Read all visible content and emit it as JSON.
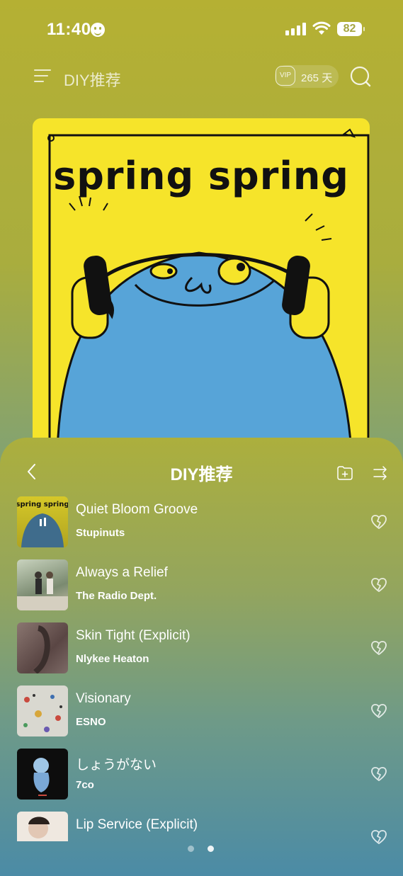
{
  "status": {
    "time": "11:40",
    "battery": "82"
  },
  "header": {
    "title": "DIY推荐",
    "vip_label": "VIP",
    "vip_days": "265 天"
  },
  "cover": {
    "text": "spring spring"
  },
  "sheet": {
    "title": "DIY推荐",
    "songs": [
      {
        "title": "Quiet Bloom Groove",
        "artist": "Stupinuts",
        "thumb_color": "#e6d430"
      },
      {
        "title": "Always a Relief",
        "artist": "The Radio Dept.",
        "thumb_color": "#8c9a86"
      },
      {
        "title": "Skin Tight (Explicit)",
        "artist": "Nlykee Heaton",
        "thumb_color": "#6e5a58"
      },
      {
        "title": "Visionary",
        "artist": "ESNO",
        "thumb_color": "#cfcfc5"
      },
      {
        "title": "しょうがない",
        "artist": "7co",
        "thumb_color": "#111111"
      },
      {
        "title": "Lip Service (Explicit)",
        "artist": "",
        "thumb_color": "#e8e0d8"
      }
    ]
  },
  "pagination": {
    "current": 2,
    "total": 2
  }
}
